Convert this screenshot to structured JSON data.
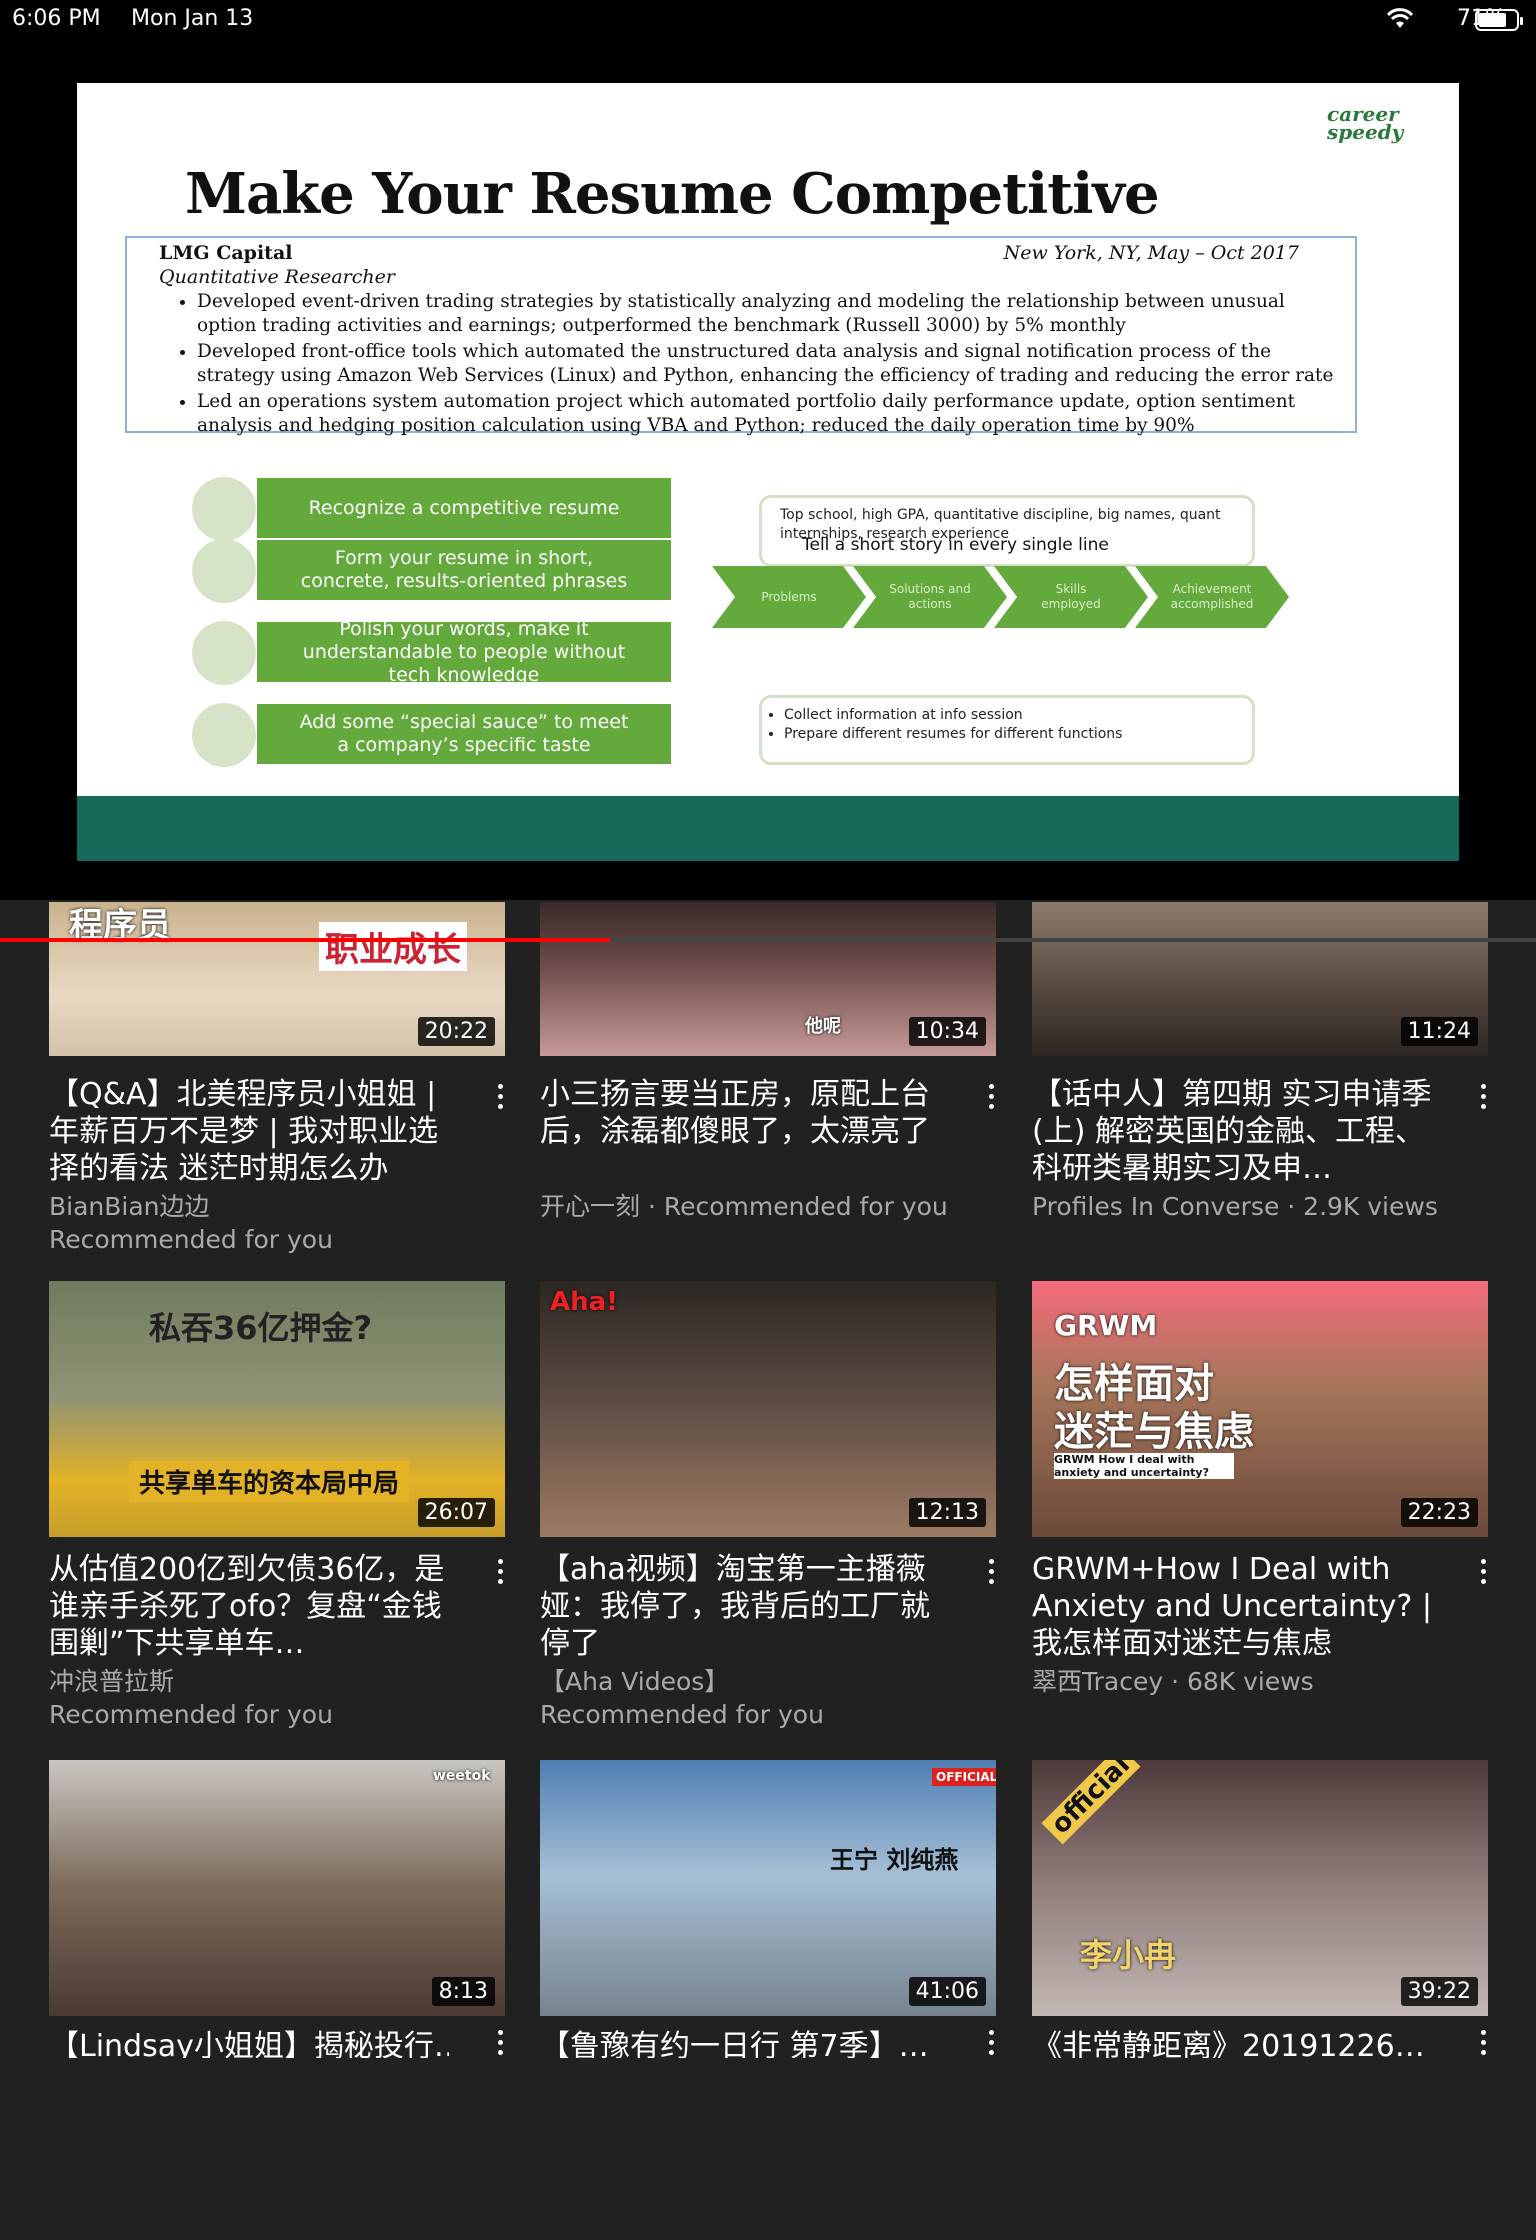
{
  "status": {
    "time": "6:06 PM",
    "date": "Mon Jan 13",
    "battery": "71%"
  },
  "player": {
    "progress_fraction": 0.397
  },
  "slide": {
    "brand_line1": "career",
    "brand_line2": "speedy",
    "title": "Make Your Resume Competitive",
    "company": "LMG Capital",
    "location": "New York, NY, May – Oct 2017",
    "role": "Quantitative Researcher",
    "bullets": [
      "Developed event-driven trading strategies by statistically analyzing and modeling the relationship between unusual option trading activities and earnings; outperformed the benchmark (Russell 3000) by 5% monthly",
      "Developed front-office tools which automated the unstructured data analysis and signal notification process of the strategy using Amazon Web Services (Linux) and Python, enhancing the efficiency of trading and reducing the error rate",
      "Led an operations system automation project which automated portfolio daily performance update, option sentiment analysis and hedging position calculation using VBA and Python; reduced the daily operation time by 90%"
    ],
    "steps": [
      "Recognize a competitive resume",
      "Form your resume in short, concrete, results-oriented phrases",
      "Polish your words, make it understandable to people without tech knowledge",
      "Add some “special sauce” to meet a company’s specific taste"
    ],
    "callout_top": "Top school, high GPA, quantitative discipline, big names, quant internships, research experience",
    "story_label": "Tell a short story in every single line",
    "story_steps": [
      "Problems",
      "Solutions and actions",
      "Skills employed",
      "Achievement accomplished"
    ],
    "callout_bottom": [
      "Collect information at info session",
      "Prepare different resumes for different functions"
    ]
  },
  "videos": [
    {
      "duration": "20:22",
      "title": "【Q&A】北美程序员小姐姐 | 年薪百万不是梦 | 我对职业选择的看法 迷茫时期怎么办",
      "meta1": "BianBian边边",
      "meta2": "Recommended for you",
      "overlay": [
        "程序员",
        "职业成长"
      ]
    },
    {
      "duration": "10:34",
      "title": "小三扬言要当正房，原配上台后，涂磊都傻眼了，太漂亮了",
      "meta1": "开心一刻 · Recommended for you",
      "meta2": "",
      "overlay": [
        "他呢"
      ]
    },
    {
      "duration": "11:24",
      "title": "【话中人】第四期 实习申请季(上) 解密英国的金融、工程、科研类暑期实习及申…",
      "meta1": "Profiles In Converse · 2.9K views",
      "meta2": "",
      "overlay": []
    },
    {
      "duration": "26:07",
      "title": "从估值200亿到欠债36亿，是谁亲手杀死了ofo？复盘“金钱围剿”下共享单车…",
      "meta1": "冲浪普拉斯",
      "meta2": "Recommended for you",
      "overlay": [
        "私吞36亿押金?",
        "共享单车的资本局中局"
      ]
    },
    {
      "duration": "12:13",
      "title": "【aha视频】淘宝第一主播薇娅：我停了，我背后的工厂就停了",
      "meta1": "【Aha Videos】",
      "meta2": "Recommended for you",
      "overlay": [
        "Aha!"
      ]
    },
    {
      "duration": "22:23",
      "title": "GRWM+How I Deal with Anxiety and Uncertainty? | 我怎样面对迷茫与焦虑",
      "meta1": "翠西Tracey · 68K views",
      "meta2": "",
      "overlay": [
        "GRWM",
        "怎样面对",
        "迷茫与焦虑",
        "GRWM How I deal with anxiety and uncertainty?"
      ]
    },
    {
      "duration": "8:13",
      "title": "【Lindsay小姐姐】揭秘投行…",
      "meta1": "",
      "meta2": "",
      "overlay": [
        "weetok"
      ]
    },
    {
      "duration": "41:06",
      "title": "【鲁豫有约一日行 第7季】…",
      "meta1": "",
      "meta2": "",
      "overlay": [
        "王宁 刘纯燕",
        "OFFICIAL"
      ]
    },
    {
      "duration": "39:22",
      "title": "《非常静距离》20191226…",
      "meta1": "",
      "meta2": "",
      "overlay": [
        "official",
        "李小冉"
      ]
    }
  ],
  "colors": {
    "background": "#212121",
    "progress": "#ff0000",
    "slide_green": "#64a93c",
    "slide_footer": "#156a59"
  }
}
